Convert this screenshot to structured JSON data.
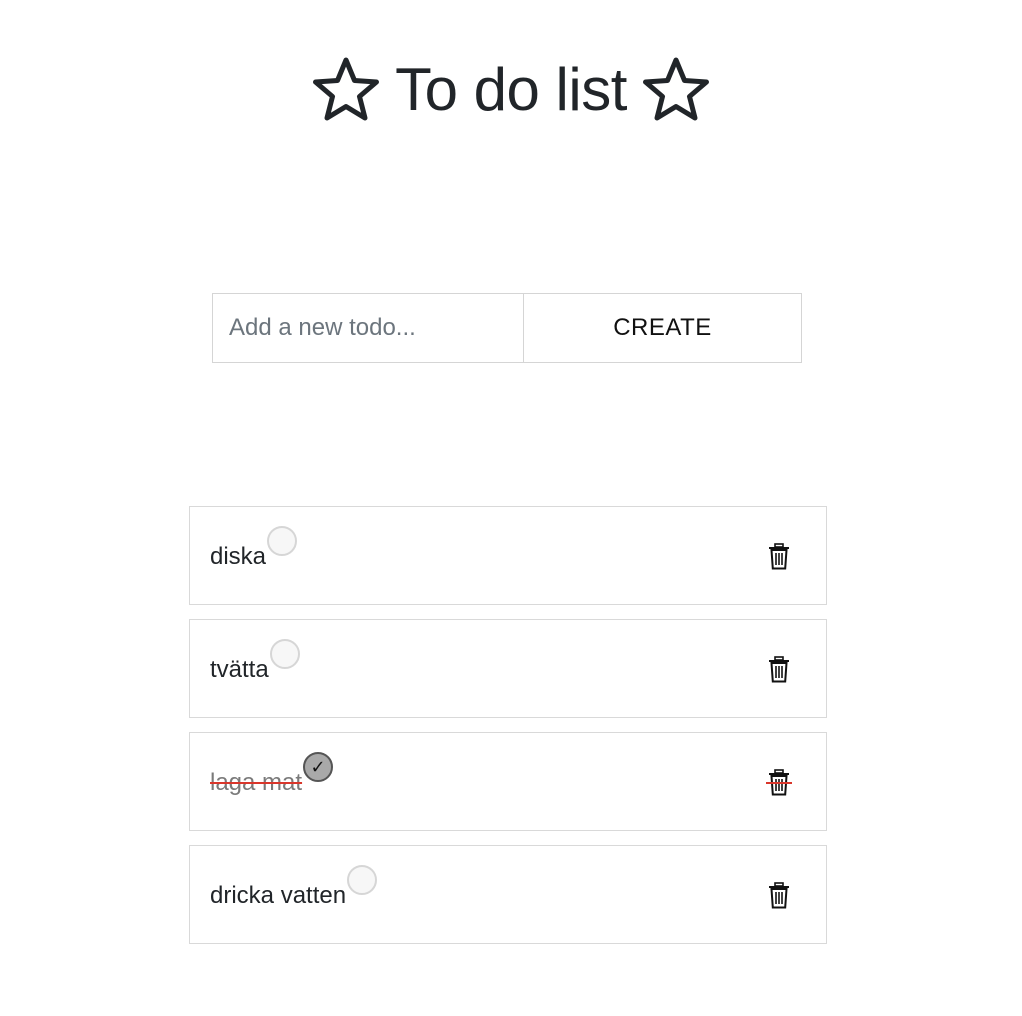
{
  "header": {
    "title": "To do list",
    "left_icon": "star-outline-icon",
    "right_icon": "star-outline-icon"
  },
  "form": {
    "input_placeholder": "Add a new todo...",
    "input_value": "",
    "create_label": "CREATE"
  },
  "todos": [
    {
      "label": "diska",
      "done": false
    },
    {
      "label": "tvätta",
      "done": false
    },
    {
      "label": "laga mat",
      "done": true
    },
    {
      "label": "dricka vatten",
      "done": false
    }
  ],
  "icons": {
    "check": "✓",
    "delete": "trash-icon"
  },
  "colors": {
    "text": "#212529",
    "border": "#d9d9d9",
    "done_strike": "#d9362b",
    "done_check_fill": "#a9a9a9"
  }
}
